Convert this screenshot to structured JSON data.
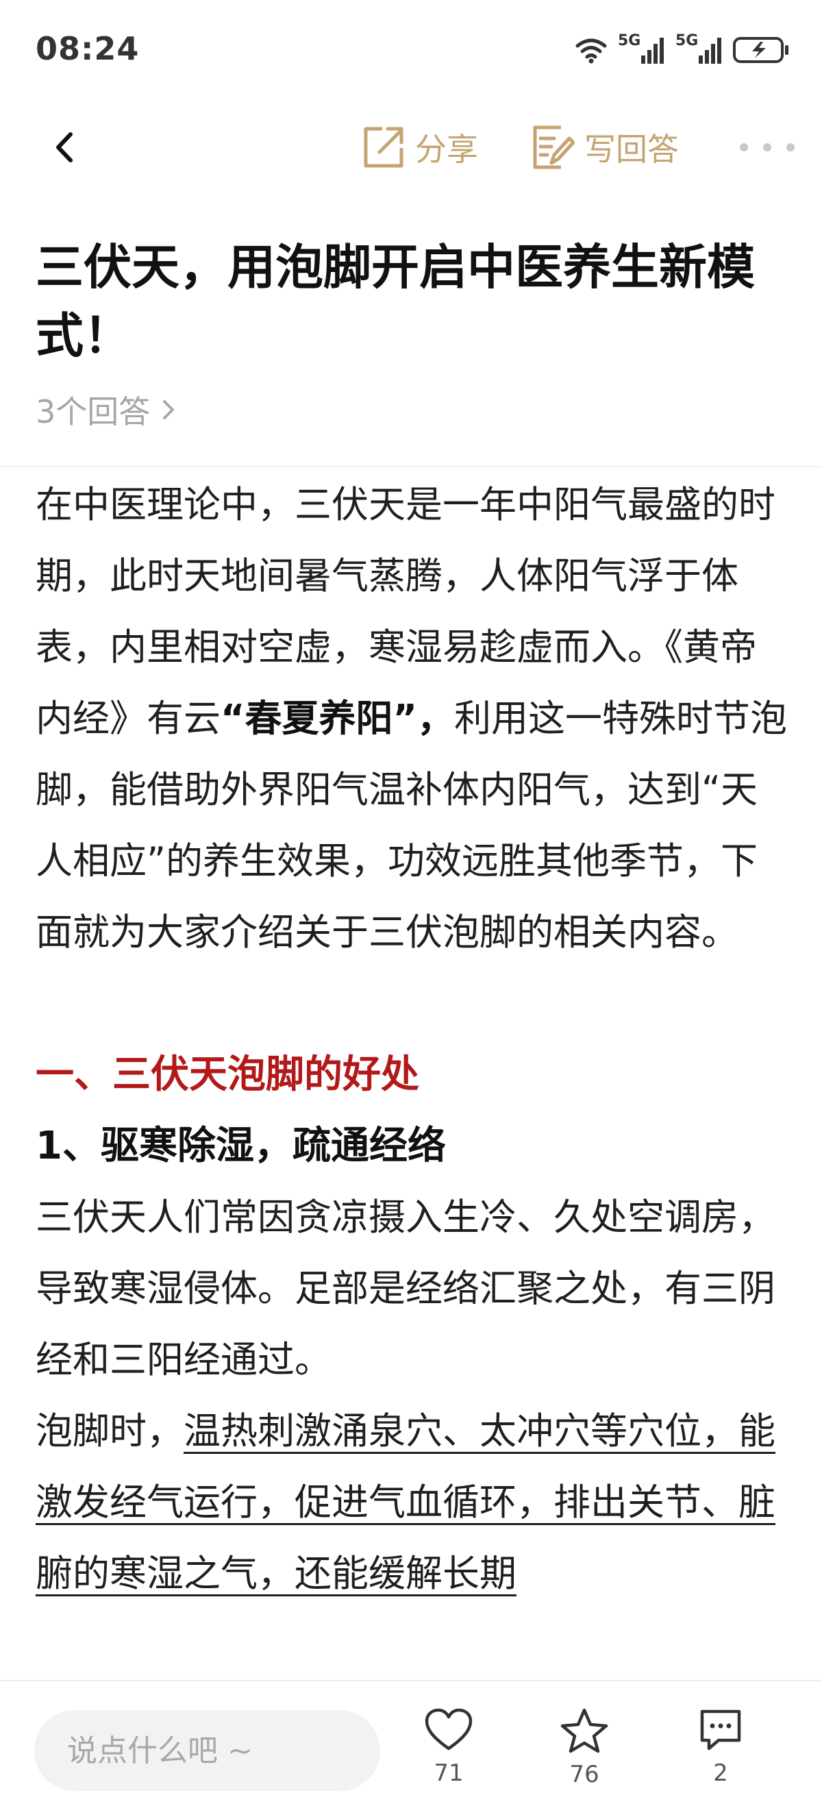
{
  "status_bar": {
    "time": "08:24",
    "net_label_1": "5G",
    "net_label_2": "5G"
  },
  "nav": {
    "share_label": "分享",
    "write_answer_label": "写回答"
  },
  "question": {
    "title": "三伏天，用泡脚开启中医养生新模式！",
    "answer_count": "3个回答"
  },
  "article": {
    "intro_part1": "在中医理论中，三伏天是一年中阳气最盛的时期，此时天地间暑气蒸腾，人体阳气浮于体表，内里相对空虚，寒湿易趁虚而入。《黄帝内经》有云",
    "intro_bold": "“春夏养阳”，",
    "intro_part2": "利用这一特殊时节泡脚，能借助外界阳气温补体内阳气，达到“天人相应”的养生效果，功效远胜其他季节，下面就为大家介绍关于三伏泡脚的相关内容。",
    "section1_heading": "一、三伏天泡脚的好处",
    "sub1_heading": "1、驱寒除湿，疏通经络",
    "sub1_para1": "三伏天人们常因贪凉摄入生冷、久处空调房，导致寒湿侵体。足部是经络汇聚之处，有三阴经和三阳经通过。",
    "sub1_para2_lead": "泡脚时，",
    "sub1_para2_underline": "温热刺激涌泉穴、太冲穴等穴位，能激发经气运行，促进气血循环，排出关节、脏腑的寒湿之气，还能缓解长期"
  },
  "bottom_bar": {
    "comment_placeholder": "说点什么吧 ~",
    "like_count": "71",
    "favorite_count": "76",
    "comment_count": "2"
  },
  "colors": {
    "accent_gold": "#c4a472",
    "heading_red": "#b31919",
    "muted_gray": "#a6a6a6"
  },
  "icons": [
    "back-icon",
    "share-icon",
    "write-answer-icon",
    "more-icon",
    "heart-icon",
    "star-icon",
    "comment-icon",
    "wifi-icon",
    "signal-icon",
    "battery-icon"
  ]
}
